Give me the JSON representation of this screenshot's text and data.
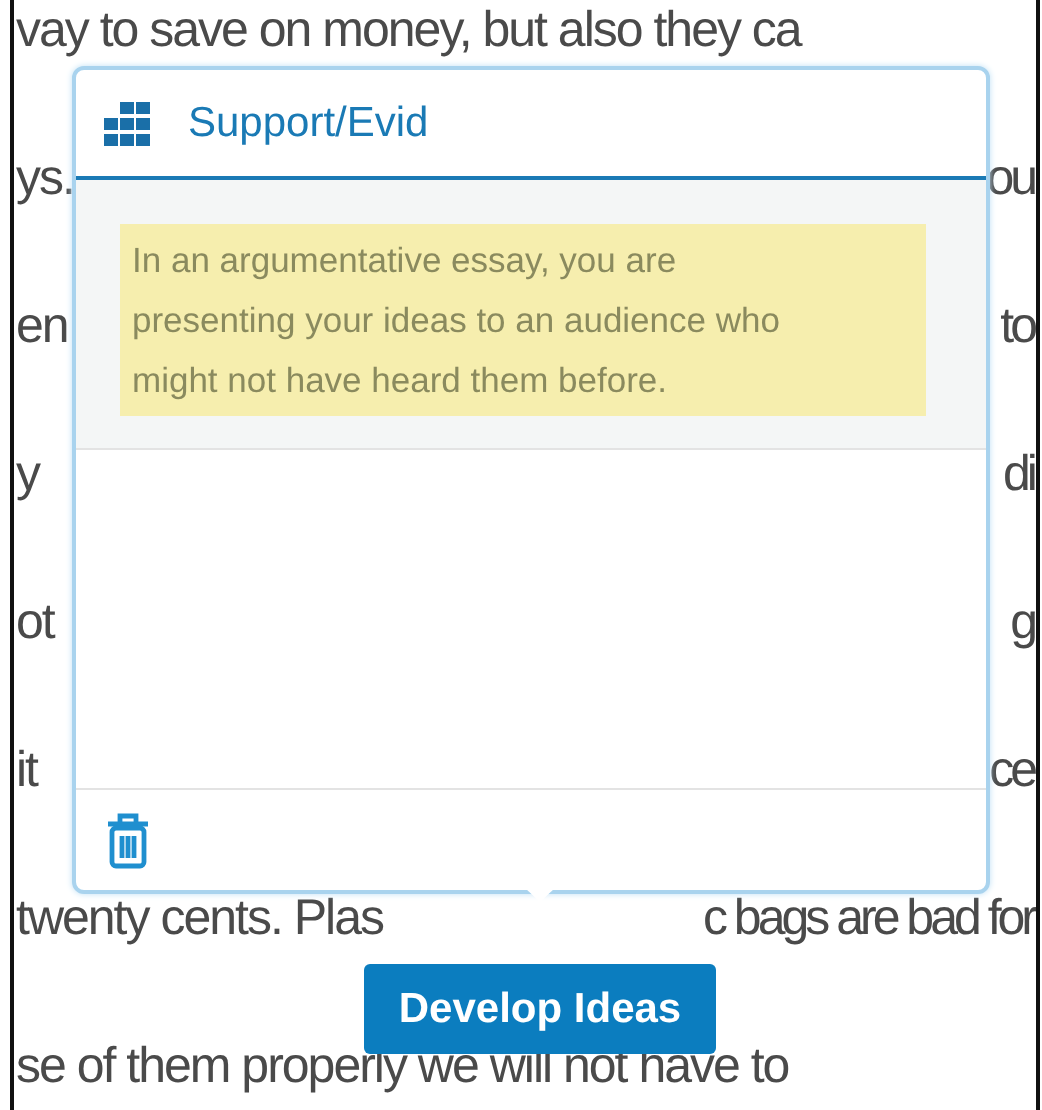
{
  "essay_lines": [
    {
      "left": "vay to save on money, but also they ca"
    },
    {
      "left": "ys.",
      "right": "ou"
    },
    {
      "left": "en",
      "right": "to"
    },
    {
      "left": "y",
      "right": "di"
    },
    {
      "left": "ot",
      "right": "g"
    },
    {
      "left": "it",
      "right": "ce"
    },
    {
      "left": "twenty cents. Plas",
      "right": "c bags are bad for"
    },
    {
      "left": "se of them properly we will not have to"
    }
  ],
  "popup": {
    "title": "Support/Evid",
    "hint": "In an argumentative essay, you are presenting your ideas to an audience who might not have heard them before."
  },
  "develop_button": "Develop Ideas"
}
